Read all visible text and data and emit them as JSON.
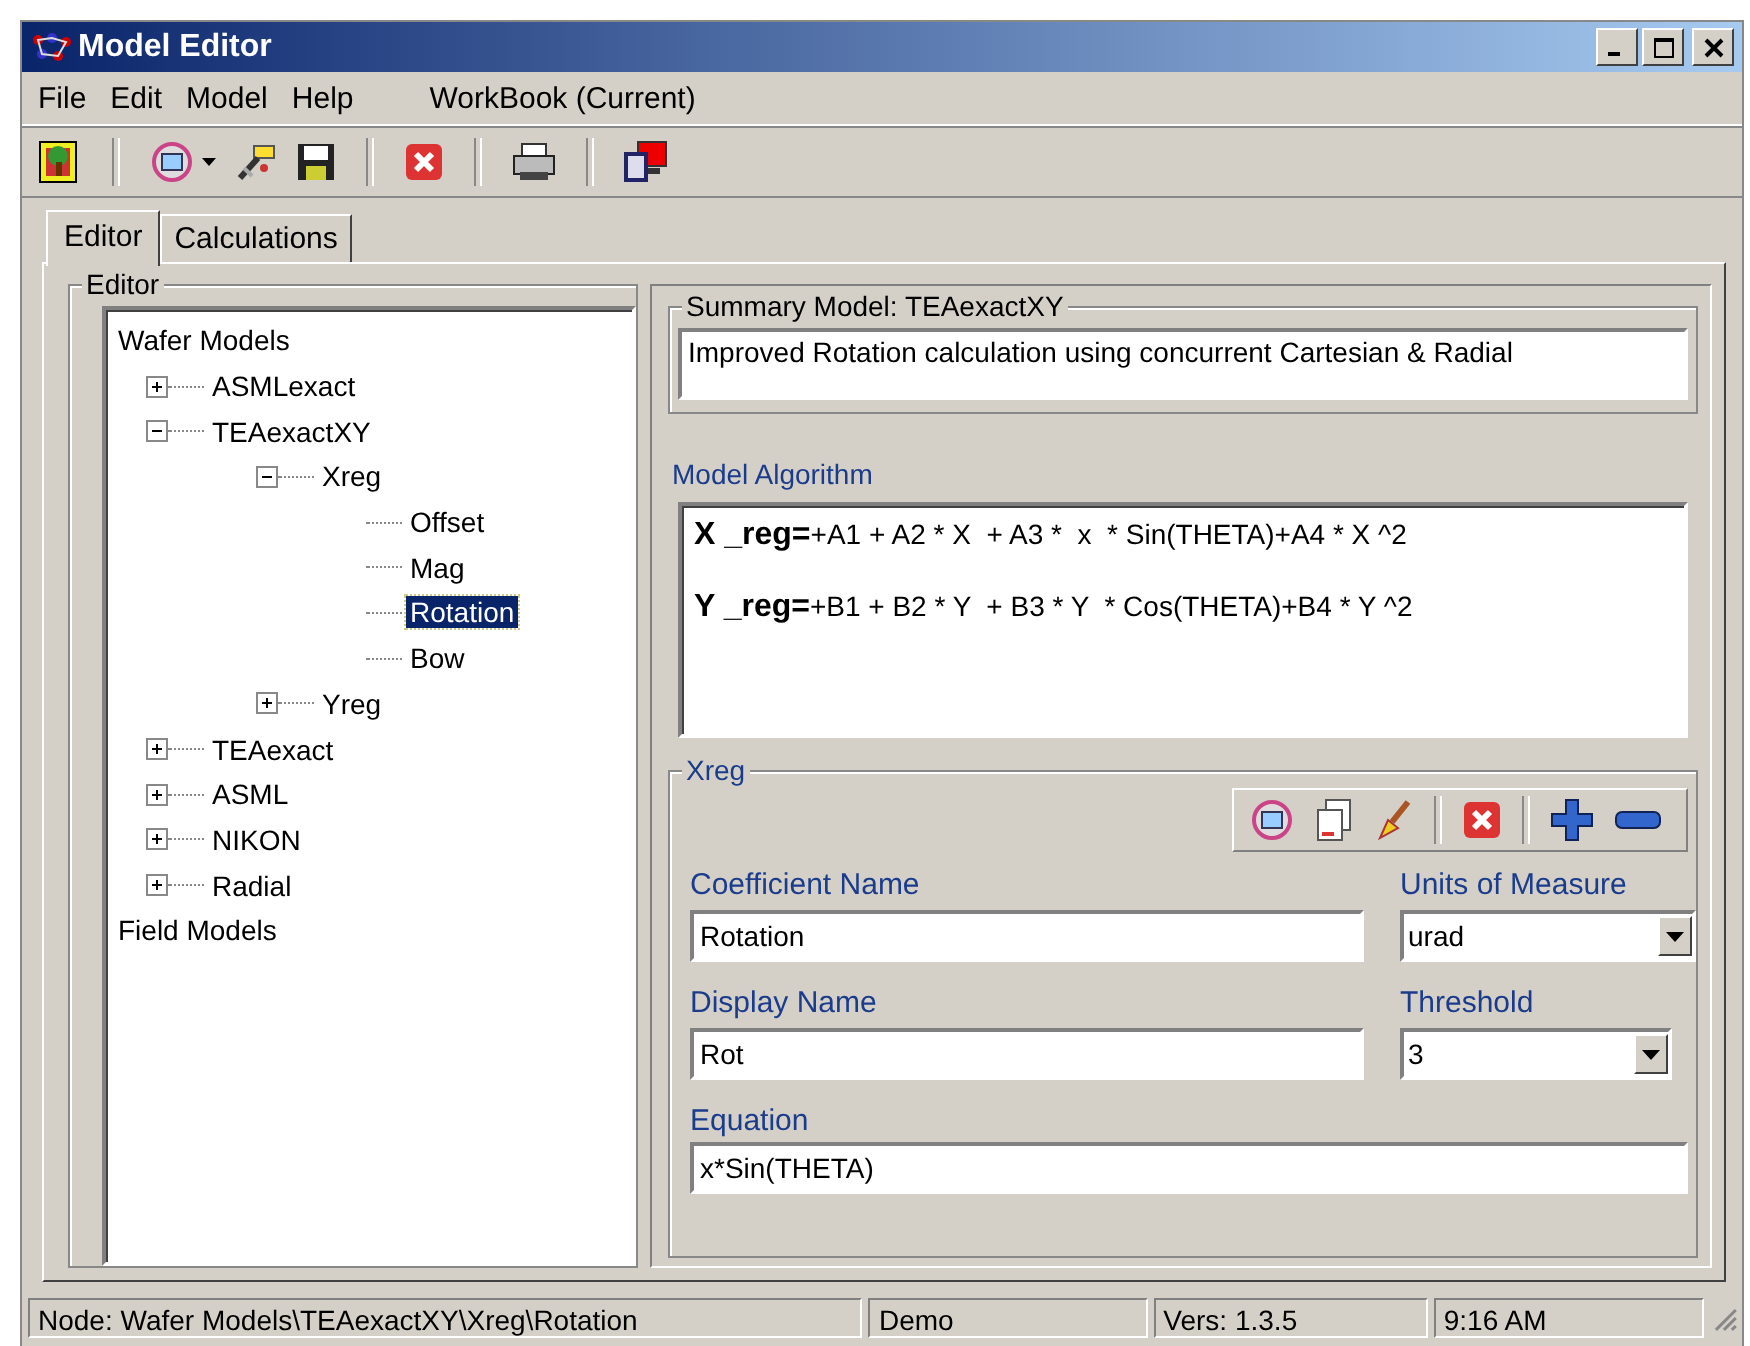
{
  "window": {
    "title": "Model Editor"
  },
  "menu": [
    {
      "label": "File"
    },
    {
      "label": "Edit"
    },
    {
      "label": "Model"
    },
    {
      "label": "Help"
    },
    {
      "label": "WorkBook (Current)"
    }
  ],
  "tabs": [
    {
      "label": "Editor",
      "selected": true
    },
    {
      "label": "Calculations",
      "selected": false
    }
  ],
  "editor_group": {
    "title": "Editor"
  },
  "tree": [
    {
      "label": "Wafer Models",
      "selected": false,
      "children": [
        {
          "label": "ASMLexact",
          "selected": false,
          "expanded": false
        },
        {
          "label": "TEAexactXY",
          "selected": false,
          "expanded": true,
          "children": [
            {
              "label": "Xreg",
              "selected": false,
              "expanded": true,
              "children": [
                {
                  "label": "Offset",
                  "selected": false
                },
                {
                  "label": "Mag",
                  "selected": false
                },
                {
                  "label": "Rotation",
                  "selected": true
                },
                {
                  "label": "Bow",
                  "selected": false
                }
              ]
            },
            {
              "label": "Yreg",
              "selected": false,
              "expanded": false
            }
          ]
        },
        {
          "label": "TEAexact",
          "selected": false,
          "expanded": false
        },
        {
          "label": "ASML",
          "selected": false,
          "expanded": false
        },
        {
          "label": "NIKON",
          "selected": false,
          "expanded": false
        },
        {
          "label": "Radial",
          "selected": false,
          "expanded": false
        }
      ]
    },
    {
      "label": "Field Models",
      "selected": false
    }
  ],
  "summary": {
    "title": "Summary Model: TEAexactXY",
    "value": "Improved Rotation calculation using concurrent Cartesian & Radial"
  },
  "algorithm": {
    "label": "Model Algorithm",
    "lines": [
      {
        "name": "X _reg=",
        "expression": "+A1 + A2 * X  + A3 *  x  * Sin(THETA)+A4 * X ^2"
      },
      {
        "name": "Y _reg=",
        "expression": "+B1 + B2 * Y  + B3 * Y  * Cos(THETA)+B4 * Y ^2"
      }
    ]
  },
  "coefficient": {
    "title": "Xreg",
    "coefficient_name": {
      "label": "Coefficient Name",
      "value": "Rotation"
    },
    "units": {
      "label": "Units of Measure",
      "value": "urad"
    },
    "display_name": {
      "label": "Display Name",
      "value": "Rot"
    },
    "threshold": {
      "label": "Threshold",
      "value": "3"
    },
    "equation": {
      "label": "Equation",
      "value": "x*Sin(THETA)"
    }
  },
  "status_bar": [
    "Node: Wafer Models\\TEAexactXY\\Xreg\\Rotation",
    "Demo",
    "Vers: 1.3.5",
    "9:16 AM"
  ]
}
